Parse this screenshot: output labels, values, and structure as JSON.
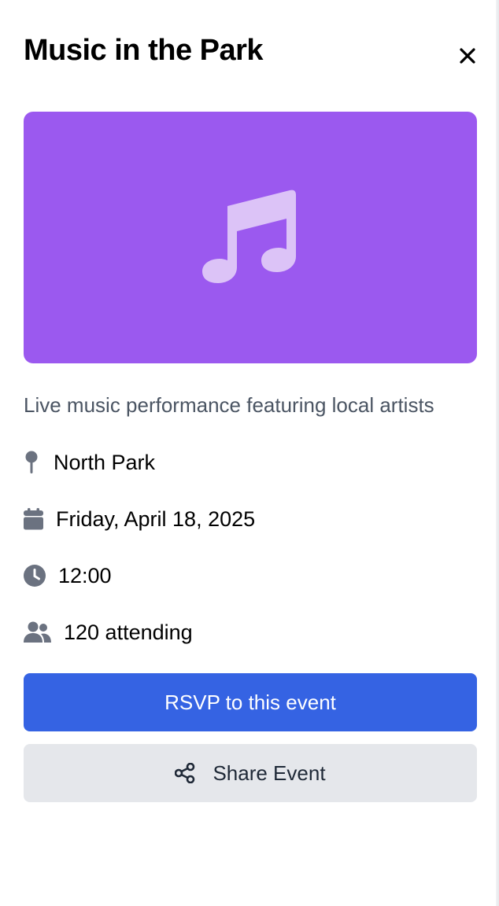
{
  "event": {
    "title": "Music in the Park",
    "description": "Live music performance featuring local artists",
    "location": "North Park",
    "date": "Friday, April 18, 2025",
    "time": "12:00",
    "attending": "120 attending"
  },
  "hero": {
    "background_color": "#9b59ef",
    "icon": "music-note-icon",
    "icon_color": "#dcc3f7"
  },
  "actions": {
    "rsvp_label": "RSVP to this event",
    "share_label": "Share Event"
  },
  "icons": {
    "close": "close-icon",
    "location": "map-pin-icon",
    "date": "calendar-icon",
    "time": "clock-icon",
    "attending": "users-icon",
    "share": "share-icon"
  },
  "colors": {
    "accent": "#3563e3",
    "secondary_button": "#e5e7eb",
    "muted_text": "#4b5563",
    "icon_gray": "#6b7280"
  }
}
